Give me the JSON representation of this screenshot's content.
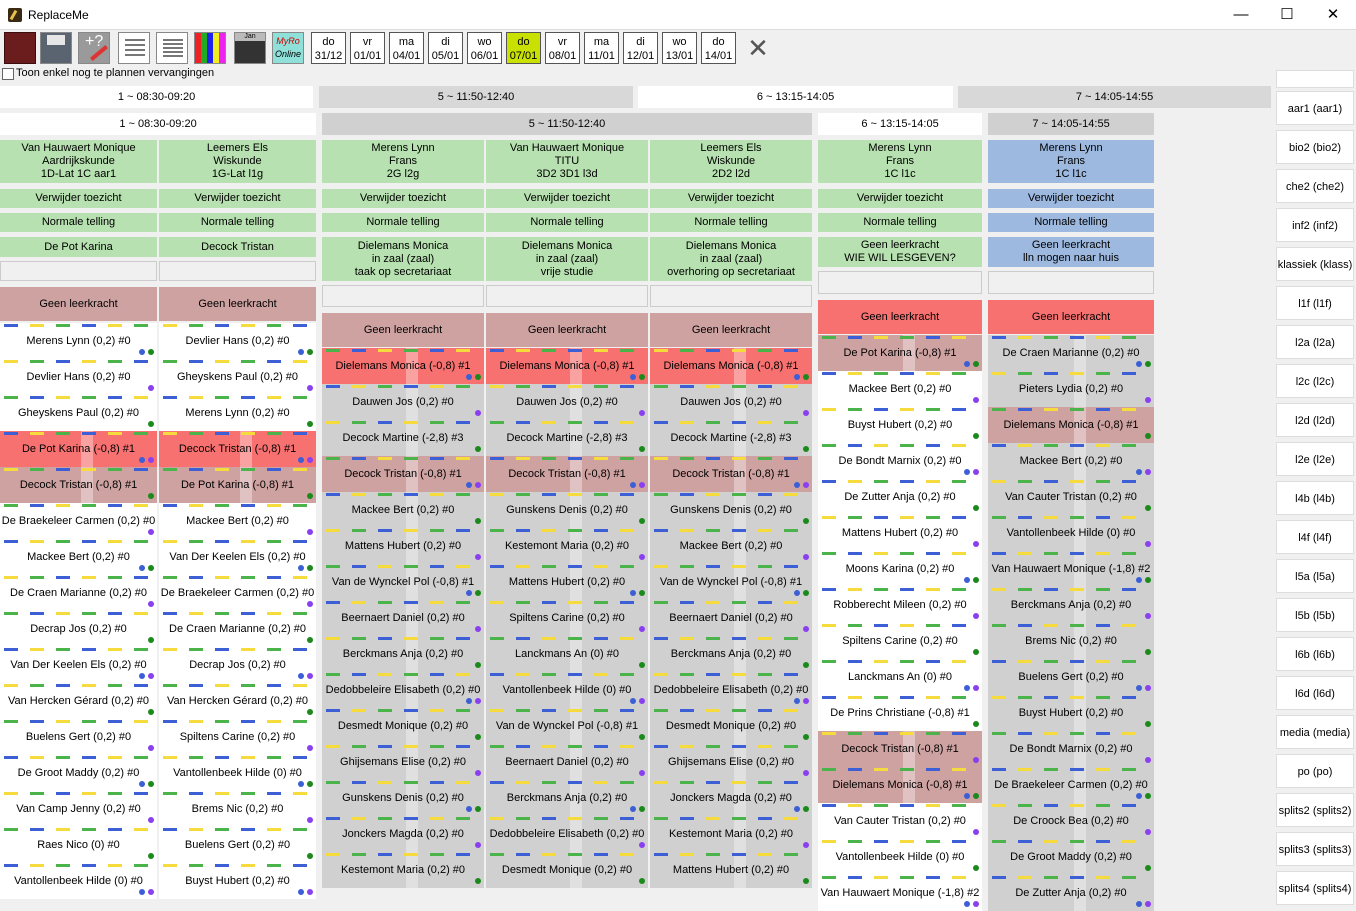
{
  "app": {
    "title": "ReplaceMe"
  },
  "window": {
    "minimize": "—",
    "maximize": "☐",
    "close": "✕"
  },
  "toolbar": {
    "icons": [
      "book-icon",
      "save-icon",
      "edit-question-icon",
      "document-icon",
      "document-lines-icon",
      "color-grid-icon",
      "calendar-icon"
    ],
    "myro_line1": "MyRo",
    "myro_line2": "Online",
    "settings_icon": "tools-icon",
    "days": [
      [
        "do",
        "31/12"
      ],
      [
        "vr",
        "01/01"
      ],
      [
        "ma",
        "04/01"
      ],
      [
        "di",
        "05/01"
      ],
      [
        "wo",
        "06/01"
      ],
      [
        "do",
        "07/01"
      ],
      [
        "vr",
        "08/01"
      ],
      [
        "ma",
        "11/01"
      ],
      [
        "di",
        "12/01"
      ],
      [
        "wo",
        "13/01"
      ],
      [
        "do",
        "14/01"
      ]
    ],
    "selected_day": 5
  },
  "filter_label": "Toon enkel nog te plannen vervangingen",
  "top_headers": [
    "1 ~ 08:30-09:20",
    "5 ~ 11:50-12:40",
    "6 ~ 13:15-14:05",
    "7 ~ 14:05-14:55"
  ],
  "hour_headers": [
    "1 ~ 08:30-09:20",
    "5 ~ 11:50-12:40",
    "6 ~ 13:15-14:05",
    "7 ~ 14:05-14:55"
  ],
  "columns": [
    {
      "teacher": "Van Hauwaert Monique",
      "subject": "Aardrijkskunde",
      "groups": "1D-Lat  1C aar1",
      "action": "Verwijder toezicht",
      "count": "Normale telling",
      "rep1": "De Pot Karina",
      "rep2": "",
      "rep3": "",
      "top": "Geen leerkracht",
      "cands": [
        [
          "Merens Lynn (0,2) #0",
          "w"
        ],
        [
          "Devlier Hans (0,2) #0",
          "w"
        ],
        [
          "Gheyskens Paul (0,2) #0",
          "w"
        ],
        [
          "De Pot Karina (-0,8) #1",
          "r"
        ],
        [
          "Decock Tristan (-0,8) #1",
          "p"
        ],
        [
          "De Braekeleer Carmen (0,2) #0",
          "w"
        ],
        [
          "Mackee Bert (0,2) #0",
          "w"
        ],
        [
          "De Craen Marianne (0,2) #0",
          "w"
        ],
        [
          "Decrap Jos (0,2) #0",
          "w"
        ],
        [
          "Van Der Keelen Els (0,2) #0",
          "w"
        ],
        [
          "Van Hercken Gérard (0,2) #0",
          "w"
        ],
        [
          "Buelens Gert (0,2) #0",
          "w"
        ],
        [
          "De Groot Maddy (0,2) #0",
          "w"
        ],
        [
          "Van Camp Jenny (0,2) #0",
          "w"
        ],
        [
          "Raes Nico (0) #0",
          "w"
        ],
        [
          "Vantollenbeek Hilde (0) #0",
          "w"
        ]
      ]
    },
    {
      "teacher": "Leemers Els",
      "subject": "Wiskunde",
      "groups": "1G-Lat l1g",
      "action": "Verwijder toezicht",
      "count": "Normale telling",
      "rep1": "Decock Tristan",
      "rep2": "",
      "rep3": "",
      "top": "Geen leerkracht",
      "cands": [
        [
          "Devlier Hans (0,2) #0",
          "w"
        ],
        [
          "Gheyskens Paul (0,2) #0",
          "w"
        ],
        [
          "Merens Lynn (0,2) #0",
          "w"
        ],
        [
          "Decock Tristan (-0,8) #1",
          "r"
        ],
        [
          "De Pot Karina (-0,8) #1",
          "p"
        ],
        [
          "Mackee Bert (0,2) #0",
          "w"
        ],
        [
          "Van Der Keelen Els (0,2) #0",
          "w"
        ],
        [
          "De Braekeleer Carmen (0,2) #0",
          "w"
        ],
        [
          "De Craen Marianne (0,2) #0",
          "w"
        ],
        [
          "Decrap Jos (0,2) #0",
          "w"
        ],
        [
          "Van Hercken Gérard (0,2) #0",
          "w"
        ],
        [
          "Spiltens Carine (0,2) #0",
          "w"
        ],
        [
          "Vantollenbeek Hilde (0) #0",
          "w"
        ],
        [
          "Brems Nic (0,2) #0",
          "w"
        ],
        [
          "Buelens Gert (0,2) #0",
          "w"
        ],
        [
          "Buyst Hubert (0,2) #0",
          "w"
        ]
      ]
    },
    {
      "teacher": "Merens Lynn",
      "subject": "Frans",
      "groups": "2G l2g",
      "action": "Verwijder toezicht",
      "count": "Normale telling",
      "rep1": "Dielemans Monica",
      "rep2": "in zaal (zaal)",
      "rep3": "taak op secretariaat",
      "top": "Geen leerkracht",
      "cands": [
        [
          "Dielemans Monica (-0,8) #1",
          "r"
        ],
        [
          "Dauwen Jos (0,2) #0",
          "g"
        ],
        [
          "Decock Martine (-2,8) #3",
          "g"
        ],
        [
          "Decock Tristan (-0,8) #1",
          "p"
        ],
        [
          "Mackee Bert (0,2) #0",
          "g"
        ],
        [
          "Mattens Hubert (0,2) #0",
          "g"
        ],
        [
          "Van de Wynckel Pol (-0,8) #1",
          "g"
        ],
        [
          "Beernaert Daniel (0,2) #0",
          "g"
        ],
        [
          "Berckmans Anja (0,2) #0",
          "g"
        ],
        [
          "Dedobbeleire Elisabeth (0,2) #0",
          "g"
        ],
        [
          "Desmedt Monique (0,2) #0",
          "g"
        ],
        [
          "Ghijsemans Elise (0,2) #0",
          "g"
        ],
        [
          "Gunskens Denis (0,2) #0",
          "g"
        ],
        [
          "Jonckers Magda (0,2) #0",
          "g"
        ],
        [
          "Kestemont Maria (0,2) #0",
          "g"
        ]
      ]
    },
    {
      "teacher": "Van Hauwaert Monique",
      "subject": "TITU",
      "groups": "3D2  3D1 l3d",
      "action": "Verwijder toezicht",
      "count": "Normale telling",
      "rep1": "Dielemans Monica",
      "rep2": "in zaal (zaal)",
      "rep3": "vrije studie",
      "top": "Geen leerkracht",
      "cands": [
        [
          "Dielemans Monica (-0,8) #1",
          "r"
        ],
        [
          "Dauwen Jos (0,2) #0",
          "g"
        ],
        [
          "Decock Martine (-2,8) #3",
          "g"
        ],
        [
          "Decock Tristan (-0,8) #1",
          "p"
        ],
        [
          "Gunskens Denis (0,2) #0",
          "g"
        ],
        [
          "Kestemont Maria (0,2) #0",
          "g"
        ],
        [
          "Mattens Hubert (0,2) #0",
          "g"
        ],
        [
          "Spiltens Carine (0,2) #0",
          "g"
        ],
        [
          "Lanckmans An (0) #0",
          "g"
        ],
        [
          "Vantollenbeek Hilde (0) #0",
          "g"
        ],
        [
          "Van de Wynckel Pol (-0,8) #1",
          "g"
        ],
        [
          "Beernaert Daniel (0,2) #0",
          "g"
        ],
        [
          "Berckmans Anja (0,2) #0",
          "g"
        ],
        [
          "Dedobbeleire Elisabeth (0,2) #0",
          "g"
        ],
        [
          "Desmedt Monique (0,2) #0",
          "g"
        ]
      ]
    },
    {
      "teacher": "Leemers Els",
      "subject": "Wiskunde",
      "groups": "2D2 l2d",
      "action": "Verwijder toezicht",
      "count": "Normale telling",
      "rep1": "Dielemans Monica",
      "rep2": "in zaal (zaal)",
      "rep3": "overhoring op secretariaat",
      "top": "Geen leerkracht",
      "cands": [
        [
          "Dielemans Monica (-0,8) #1",
          "r"
        ],
        [
          "Dauwen Jos (0,2) #0",
          "g"
        ],
        [
          "Decock Martine (-2,8) #3",
          "g"
        ],
        [
          "Decock Tristan (-0,8) #1",
          "p"
        ],
        [
          "Gunskens Denis (0,2) #0",
          "g"
        ],
        [
          "Mackee Bert (0,2) #0",
          "g"
        ],
        [
          "Van de Wynckel Pol (-0,8) #1",
          "g"
        ],
        [
          "Beernaert Daniel (0,2) #0",
          "g"
        ],
        [
          "Berckmans Anja (0,2) #0",
          "g"
        ],
        [
          "Dedobbeleire Elisabeth (0,2) #0",
          "g"
        ],
        [
          "Desmedt Monique (0,2) #0",
          "g"
        ],
        [
          "Ghijsemans Elise (0,2) #0",
          "g"
        ],
        [
          "Jonckers Magda (0,2) #0",
          "g"
        ],
        [
          "Kestemont Maria (0,2) #0",
          "g"
        ],
        [
          "Mattens Hubert (0,2) #0",
          "g"
        ]
      ]
    },
    {
      "teacher": "Merens Lynn",
      "subject": "Frans",
      "groups": "1C l1c",
      "action": "Verwijder toezicht",
      "count": "Normale telling",
      "rep1": "Geen leerkracht",
      "rep2": "WIE WIL LESGEVEN?",
      "rep3": "",
      "top": "Geen leerkracht",
      "cands": [
        [
          "De Pot Karina (-0,8) #1",
          "p"
        ],
        [
          "Mackee Bert (0,2) #0",
          "w"
        ],
        [
          "Buyst Hubert (0,2) #0",
          "w"
        ],
        [
          "De Bondt Marnix (0,2) #0",
          "w"
        ],
        [
          "De Zutter Anja (0,2) #0",
          "w"
        ],
        [
          "Mattens Hubert (0,2) #0",
          "w"
        ],
        [
          "Moons Karina (0,2) #0",
          "w"
        ],
        [
          "Robberecht Mileen (0,2) #0",
          "w"
        ],
        [
          "Spiltens Carine (0,2) #0",
          "w"
        ],
        [
          "Lanckmans An (0) #0",
          "w"
        ],
        [
          "De Prins Christiane (-0,8) #1",
          "w"
        ],
        [
          "Decock Tristan (-0,8) #1",
          "p"
        ],
        [
          "Dielemans Monica (-0,8) #1",
          "p"
        ],
        [
          "Van Cauter Tristan (0,2) #0",
          "w"
        ],
        [
          "Vantollenbeek Hilde (0) #0",
          "w"
        ],
        [
          "Van Hauwaert Monique (-1,8) #2",
          "w"
        ]
      ]
    },
    {
      "teacher": "Merens Lynn",
      "subject": "Frans",
      "groups": "1C l1c",
      "action": "Verwijder toezicht",
      "count": "Normale telling",
      "rep1": "Geen leerkracht",
      "rep2": "lln mogen naar huis",
      "rep3": "",
      "top": "Geen leerkracht",
      "cands": [
        [
          "De Craen Marianne (0,2) #0",
          "g"
        ],
        [
          "Pieters Lydia (0,2) #0",
          "g"
        ],
        [
          "Dielemans Monica (-0,8) #1",
          "p"
        ],
        [
          "Mackee Bert (0,2) #0",
          "g"
        ],
        [
          "Van Cauter Tristan (0,2) #0",
          "g"
        ],
        [
          "Vantollenbeek Hilde (0) #0",
          "g"
        ],
        [
          "Van Hauwaert Monique (-1,8) #2",
          "g"
        ],
        [
          "Berckmans Anja (0,2) #0",
          "g"
        ],
        [
          "Brems Nic (0,2) #0",
          "g"
        ],
        [
          "Buelens Gert (0,2) #0",
          "g"
        ],
        [
          "Buyst Hubert (0,2) #0",
          "g"
        ],
        [
          "De Bondt Marnix (0,2) #0",
          "g"
        ],
        [
          "De Braekeleer Carmen (0,2) #0",
          "g"
        ],
        [
          "De Croock Bea (0,2) #0",
          "g"
        ],
        [
          "De Groot Maddy (0,2) #0",
          "g"
        ],
        [
          "De Zutter Anja (0,2) #0",
          "g"
        ]
      ]
    }
  ],
  "classes": [
    "aar1 (aar1)",
    "bio2 (bio2)",
    "che2 (che2)",
    "inf2 (inf2)",
    "klassiek (klass)",
    "l1f (l1f)",
    "l2a (l2a)",
    "l2c (l2c)",
    "l2d (l2d)",
    "l2e (l2e)",
    "l4b (l4b)",
    "l4f (l4f)",
    "l5a (l5a)",
    "l5b (l5b)",
    "l6b (l6b)",
    "l6d (l6d)",
    "media (media)",
    "po (po)",
    "splits2 (splits2)",
    "splits3 (splits3)",
    "splits4 (splits4)"
  ],
  "colors": {
    "green": "#b7e1b0",
    "blue": "#9db9e0",
    "red": "#f87171",
    "pink": "#cfa2a2",
    "gray": "#d0d0d0",
    "selected_day": "#c8e100"
  }
}
